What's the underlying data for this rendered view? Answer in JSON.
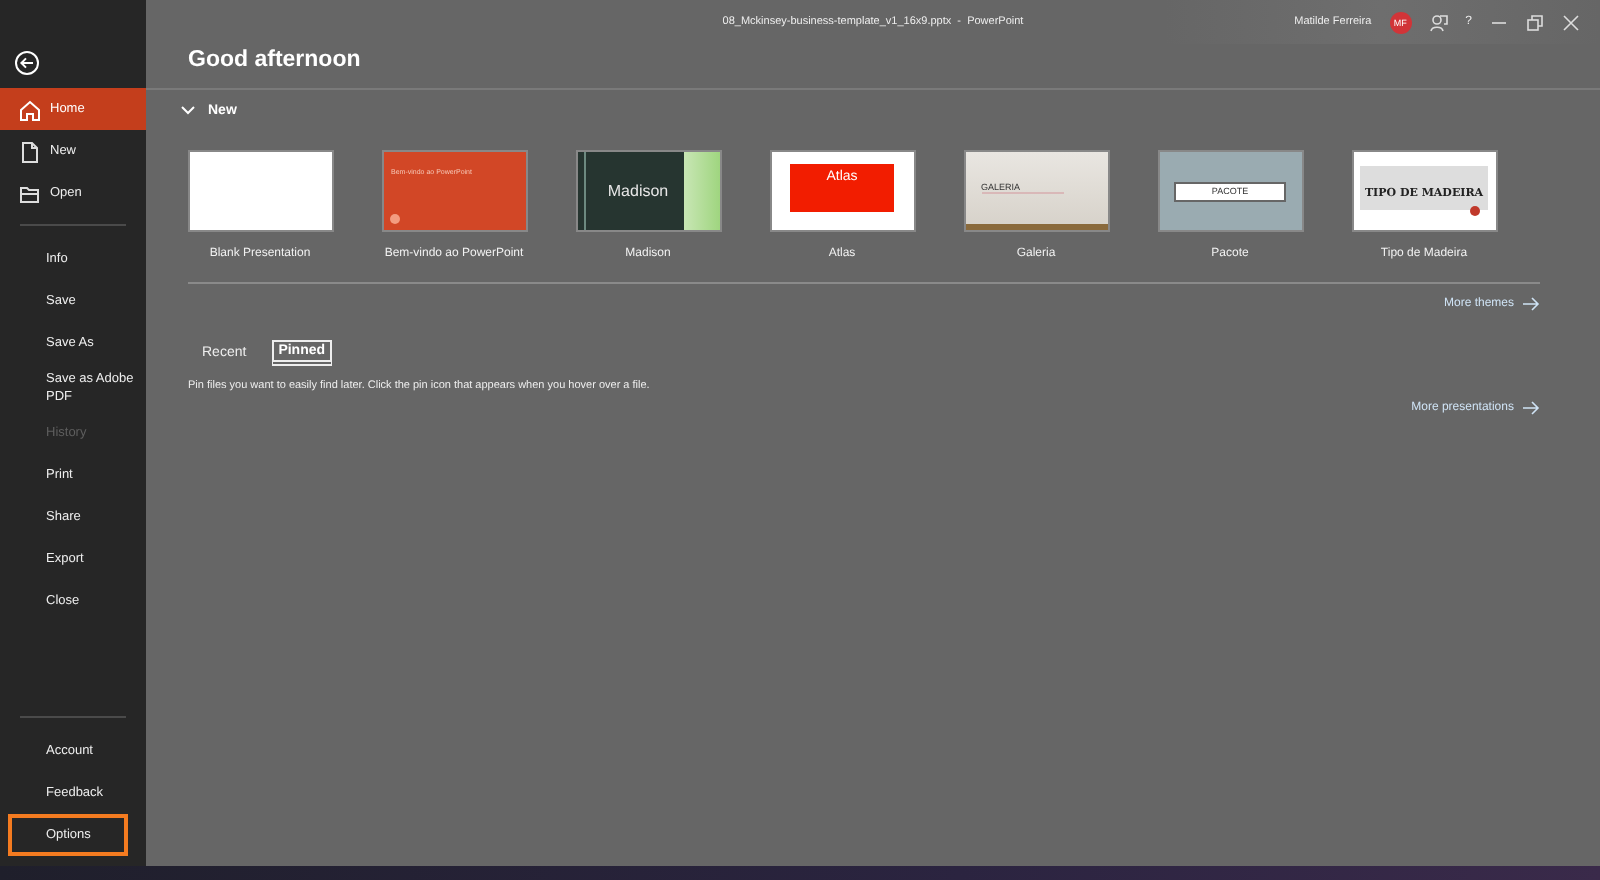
{
  "window": {
    "title": "08_Mckinsey-business-template_v1_16x9.pptx  -  PowerPoint",
    "user": "Matilde Ferreira",
    "avatar": "MF",
    "help": "?"
  },
  "sidebar": {
    "items": [
      {
        "label": "Home",
        "kind": "nav",
        "selected": true,
        "disabled": false,
        "highlighted": false
      },
      {
        "label": "New",
        "kind": "nav",
        "selected": false,
        "disabled": false,
        "highlighted": false
      },
      {
        "label": "Open",
        "kind": "nav",
        "selected": false,
        "disabled": false,
        "highlighted": false
      },
      {
        "label": "Info",
        "kind": "command",
        "selected": false,
        "disabled": false,
        "highlighted": false
      },
      {
        "label": "Save",
        "kind": "command",
        "selected": false,
        "disabled": false,
        "highlighted": false
      },
      {
        "label": "Save As",
        "kind": "command",
        "selected": false,
        "disabled": false,
        "highlighted": false
      },
      {
        "label": "Save as Adobe PDF",
        "kind": "command",
        "selected": false,
        "disabled": false,
        "highlighted": false
      },
      {
        "label": "History",
        "kind": "command",
        "selected": false,
        "disabled": true,
        "highlighted": false
      },
      {
        "label": "Print",
        "kind": "command",
        "selected": false,
        "disabled": false,
        "highlighted": false
      },
      {
        "label": "Share",
        "kind": "command",
        "selected": false,
        "disabled": false,
        "highlighted": false
      },
      {
        "label": "Export",
        "kind": "command",
        "selected": false,
        "disabled": false,
        "highlighted": false
      },
      {
        "label": "Close",
        "kind": "command",
        "selected": false,
        "disabled": false,
        "highlighted": false
      }
    ],
    "footer_items": [
      {
        "label": "Account",
        "selected": false,
        "disabled": false,
        "highlighted": false
      },
      {
        "label": "Feedback",
        "selected": false,
        "disabled": false,
        "highlighted": false
      },
      {
        "label": "Options",
        "selected": false,
        "disabled": false,
        "highlighted": true
      }
    ]
  },
  "greeting": "Good afternoon",
  "new_section": {
    "title": "New",
    "expanded": true,
    "templates": [
      {
        "name": "Blank Presentation",
        "kind": "blank"
      },
      {
        "name": "Bem-vindo ao PowerPoint",
        "kind": "welcome",
        "thumbnail_text": "Bem-vindo ao PowerPoint"
      },
      {
        "name": "Madison",
        "kind": "madison",
        "thumbnail_text": "Madison"
      },
      {
        "name": "Atlas",
        "kind": "atlas",
        "thumbnail_text": "Atlas"
      },
      {
        "name": "Galeria",
        "kind": "galeria",
        "thumbnail_text": "GALERIA"
      },
      {
        "name": "Pacote",
        "kind": "pacote",
        "thumbnail_text": "PACOTE"
      },
      {
        "name": "Tipo de Madeira",
        "kind": "madeira",
        "thumbnail_text": "TIPO DE MADEIRA"
      }
    ],
    "more_link": "More themes"
  },
  "files": {
    "tabs": [
      {
        "label": "Recent",
        "selected": false
      },
      {
        "label": "Pinned",
        "selected": true
      }
    ],
    "message": "Pin files you want to easily find later. Click the pin icon that appears when you hover over a file.",
    "more_link": "More presentations"
  }
}
